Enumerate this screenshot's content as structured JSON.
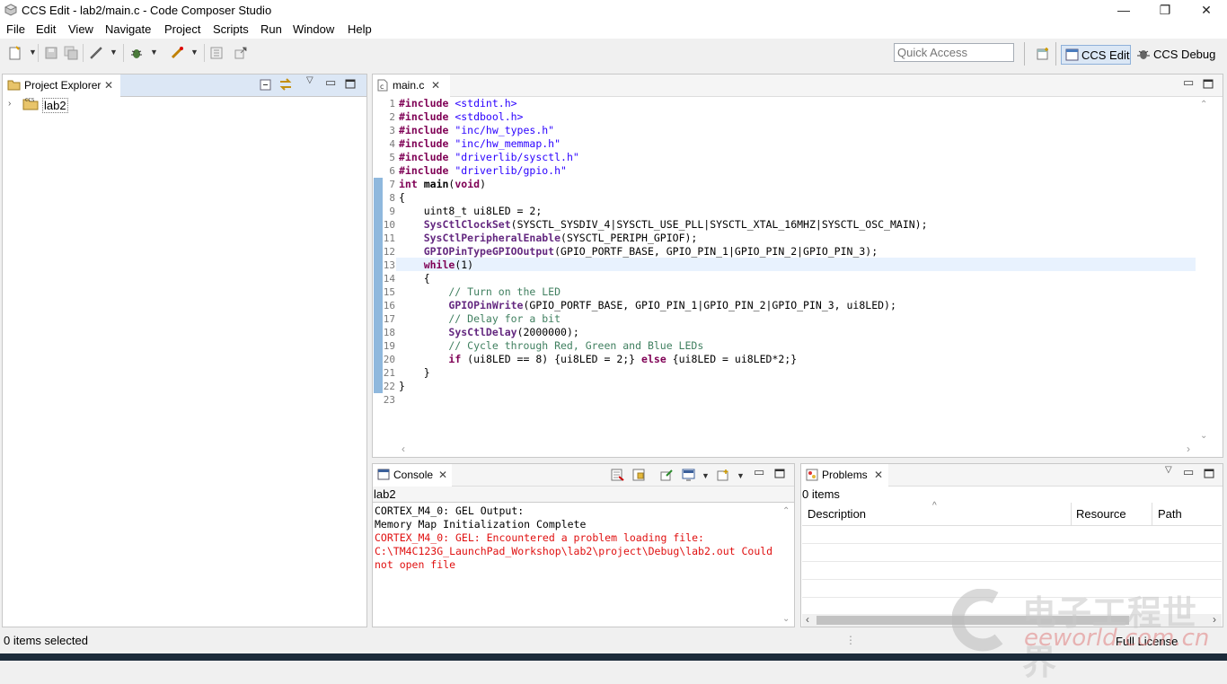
{
  "window": {
    "title": "CCS Edit - lab2/main.c - Code Composer Studio",
    "minimize": "—",
    "restore": "❐",
    "close": "✕"
  },
  "menu": [
    "File",
    "Edit",
    "View",
    "Navigate",
    "Project",
    "Scripts",
    "Run",
    "Window",
    "Help"
  ],
  "toolbar": {
    "quick_access_placeholder": "Quick Access",
    "perspective_edit": "CCS Edit",
    "perspective_debug": "CCS Debug"
  },
  "project_explorer": {
    "tab_label": "Project Explorer",
    "items": [
      {
        "label": "lab2"
      }
    ]
  },
  "editor": {
    "tab_label": "main.c",
    "lines": [
      {
        "n": "1"
      },
      {
        "n": "2"
      },
      {
        "n": "3"
      },
      {
        "n": "4"
      },
      {
        "n": "5"
      },
      {
        "n": "6"
      },
      {
        "n": "7"
      },
      {
        "n": "8"
      },
      {
        "n": "9"
      },
      {
        "n": "10"
      },
      {
        "n": "11"
      },
      {
        "n": "12"
      },
      {
        "n": "13"
      },
      {
        "n": "14"
      },
      {
        "n": "15"
      },
      {
        "n": "16"
      },
      {
        "n": "17"
      },
      {
        "n": "18"
      },
      {
        "n": "19"
      },
      {
        "n": "20"
      },
      {
        "n": "21"
      },
      {
        "n": "22"
      },
      {
        "n": "23"
      }
    ],
    "code": {
      "l1a": "#include",
      "l1b": " <stdint.h>",
      "l2a": "#include",
      "l2b": " <stdbool.h>",
      "l3a": "#include",
      "l3b": " \"inc/hw_types.h\"",
      "l4a": "#include",
      "l4b": " \"inc/hw_memmap.h\"",
      "l5a": "#include",
      "l5b": " \"driverlib/sysctl.h\"",
      "l6a": "#include",
      "l6b": " \"driverlib/gpio.h\"",
      "l7a": "int",
      "l7b": " ",
      "l7c": "main",
      "l7d": "(",
      "l7e": "void",
      "l7f": ")",
      "l8": "{",
      "l9": "    uint8_t ui8LED = 2;",
      "l10a": "    ",
      "l10b": "SysCtlClockSet",
      "l10c": "(SYSCTL_SYSDIV_4|SYSCTL_USE_PLL|SYSCTL_XTAL_16MHZ|SYSCTL_OSC_MAIN);",
      "l11a": "    ",
      "l11b": "SysCtlPeripheralEnable",
      "l11c": "(SYSCTL_PERIPH_GPIOF);",
      "l12a": "    ",
      "l12b": "GPIOPinTypeGPIOOutput",
      "l12c": "(GPIO_PORTF_BASE, GPIO_PIN_1|GPIO_PIN_2|GPIO_PIN_3);",
      "l13a": "    ",
      "l13b": "while",
      "l13c": "(1)",
      "l14": "    {",
      "l15": "        // Turn on the LED",
      "l16a": "        ",
      "l16b": "GPIOPinWrite",
      "l16c": "(GPIO_PORTF_BASE, GPIO_PIN_1|GPIO_PIN_2|GPIO_PIN_3, ui8LED);",
      "l17": "        // Delay for a bit",
      "l18a": "        ",
      "l18b": "SysCtlDelay",
      "l18c": "(2000000);",
      "l19": "        // Cycle through Red, Green and Blue LEDs",
      "l20a": "        ",
      "l20b": "if",
      "l20c": " (ui8LED == 8) {ui8LED = 2;} ",
      "l20d": "else",
      "l20e": " {ui8LED = ui8LED*2;}",
      "l21": "    }",
      "l22": "}",
      "l23": ""
    }
  },
  "console": {
    "tab_label": "Console",
    "project": "lab2",
    "lines": [
      "CORTEX_M4_0: GEL Output:",
      "Memory Map Initialization Complete",
      "CORTEX_M4_0: GEL: Encountered a problem loading file:",
      "C:\\TM4C123G_LaunchPad_Workshop\\lab2\\project\\Debug\\lab2.out Could",
      "not open file"
    ]
  },
  "problems": {
    "tab_label": "Problems",
    "count": "0 items",
    "columns": [
      "Description",
      "Resource",
      "Path"
    ]
  },
  "status": {
    "selection": "0 items selected",
    "license": "Full License"
  },
  "watermark": {
    "cn": "电子工程世界",
    "en": "eeworld.com.cn"
  },
  "colors": {
    "keyword": "#7f0055",
    "string": "#2a00ff",
    "function": "#642880",
    "comment": "#3f7f5f",
    "error": "#e01010",
    "selection_bar": "#8fb8dd"
  }
}
